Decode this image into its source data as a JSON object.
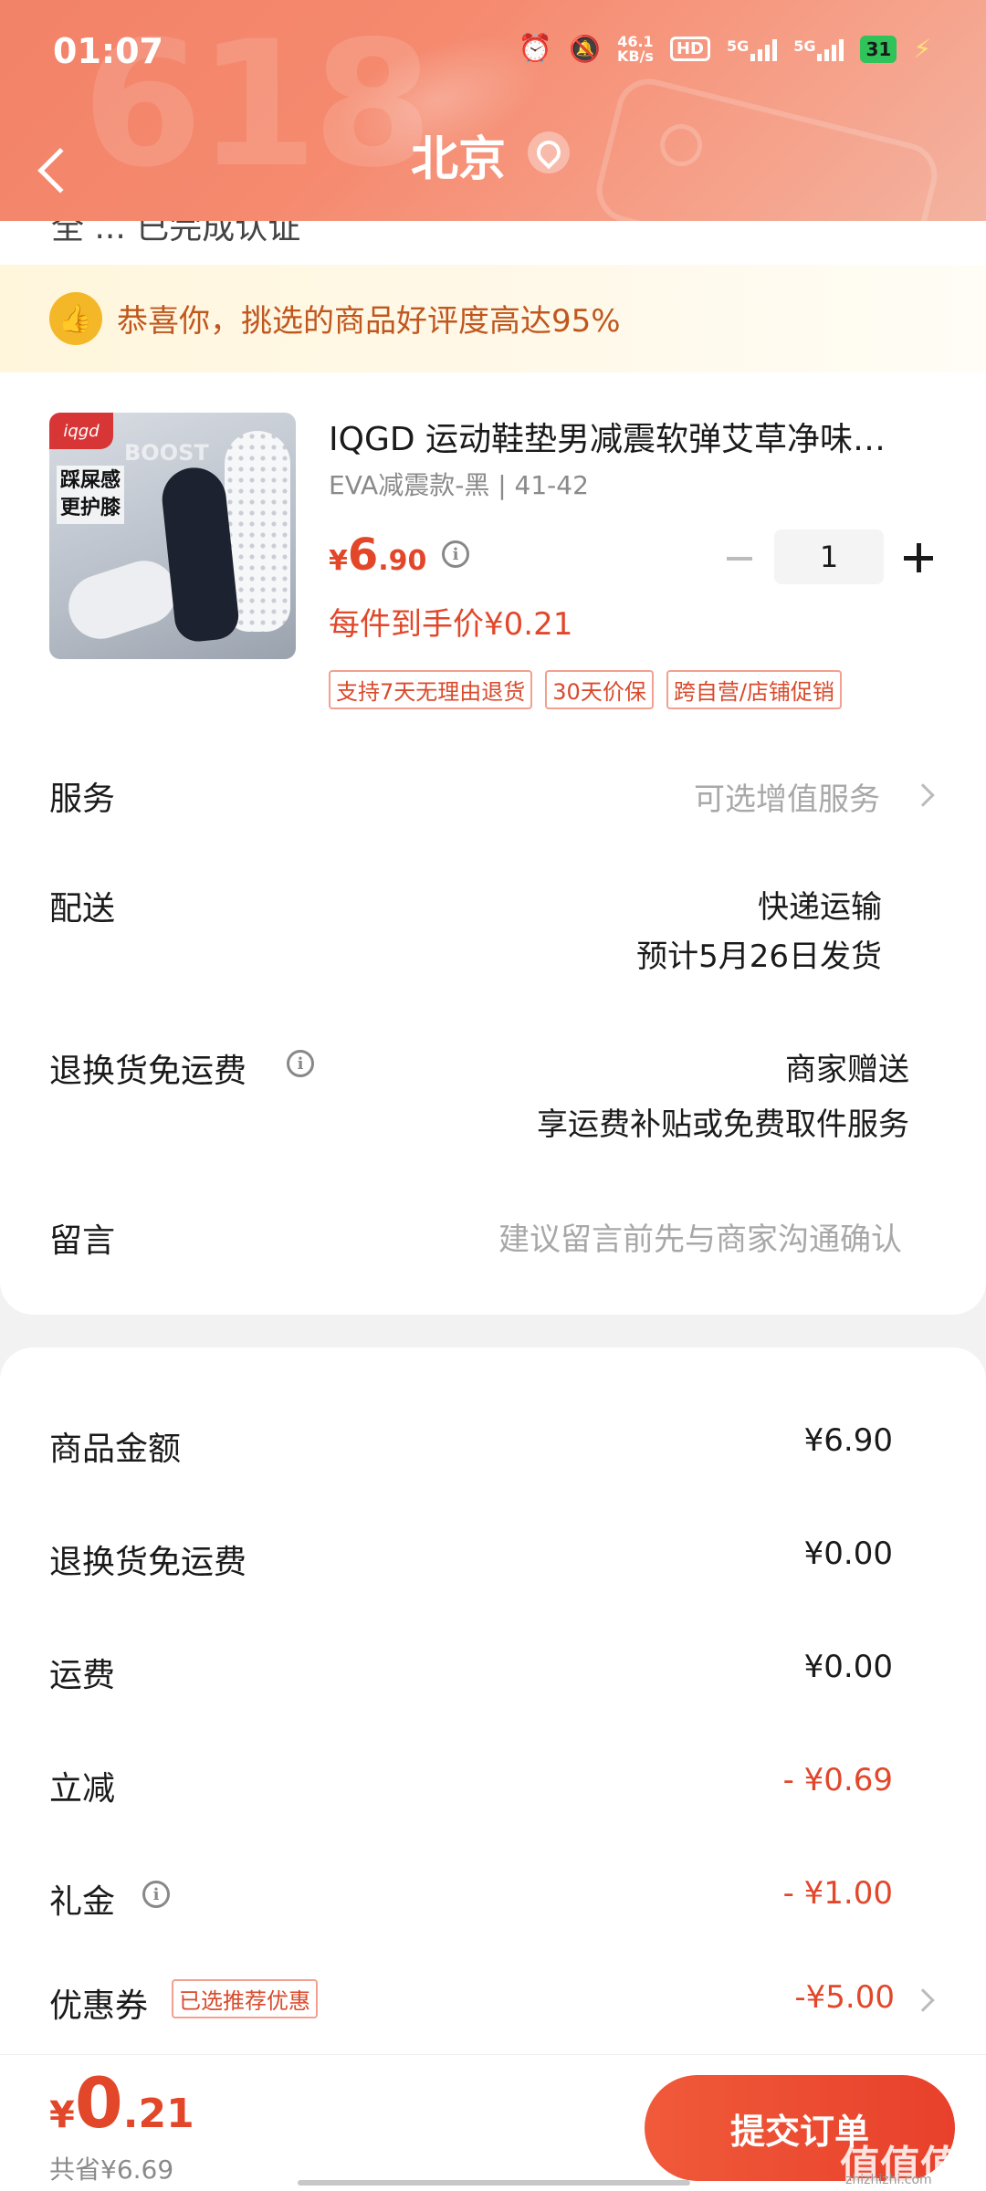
{
  "status_bar": {
    "time": "01:07",
    "net_speed_value": "46.1",
    "net_speed_unit": "KB/s",
    "hd_label": "HD",
    "sim1_label": "5G",
    "sim2_label": "5G",
    "battery": "31"
  },
  "header": {
    "city": "北京",
    "decoration_text": "618"
  },
  "partial_text": "全 ... 已完成认证",
  "banner": {
    "text": "恭喜你，挑选的商品好评度高达95%"
  },
  "product": {
    "image_logo": "iqgd",
    "image_boost": "BOOST",
    "image_tagline": "踩屎感\n更护膝",
    "title": "IQGD 运动鞋垫男减震软弹艾草净味…",
    "spec": "EVA减震款-黑 | 41-42",
    "price_currency": "¥",
    "price_int": "6",
    "price_dec": ".90",
    "quantity": "1",
    "unit_price": "每件到手价¥0.21",
    "tags": [
      "支持7天无理由退货",
      "30天价保",
      "跨自营/店铺促销"
    ]
  },
  "rows": {
    "service_label": "服务",
    "service_value": "可选增值服务",
    "delivery_label": "配送",
    "delivery_value1": "快递运输",
    "delivery_value2": "预计5月26日发货",
    "return_label": "退换货免运费",
    "return_value1": "商家赠送",
    "return_value2": "享运费补贴或免费取件服务",
    "message_label": "留言",
    "message_placeholder": "建议留言前先与商家沟通确认"
  },
  "summary": {
    "goods_label": "商品金额",
    "goods_value": "¥6.90",
    "return_label": "退换货免运费",
    "return_value": "¥0.00",
    "shipping_label": "运费",
    "shipping_value": "¥0.00",
    "discount_label": "立减",
    "discount_value": "- ¥0.69",
    "gift_label": "礼金",
    "gift_value": "- ¥1.00",
    "coupon_label": "优惠券",
    "coupon_badge": "已选推荐优惠",
    "coupon_value": "-¥5.00"
  },
  "bottom": {
    "total_currency": "¥",
    "total_int": "0",
    "total_dec": ".21",
    "saved": "共省¥6.69",
    "submit_label": "提交订单",
    "watermark": "值值值",
    "watermark_sub": "zhizhizhi.com"
  },
  "colors": {
    "accent_red": "#e2472a",
    "header_gradient_start": "#f28268",
    "banner_text": "#c0571e"
  }
}
